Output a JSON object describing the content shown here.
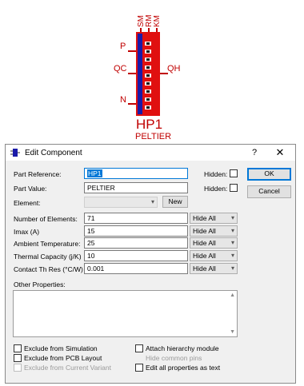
{
  "schematic": {
    "top_pins": [
      "SM",
      "RM",
      "KM"
    ],
    "left_pins": [
      "P",
      "QC",
      "N"
    ],
    "right_pins": [
      "QH"
    ],
    "reference": "HP1",
    "value": "PELTIER",
    "colors": {
      "wire": "#c00000",
      "body": "#e01010",
      "accent": "#1a1aa8"
    }
  },
  "dialog": {
    "title": "Edit Component",
    "help_label": "?",
    "close_label": "✕",
    "part_reference_label": "Part Reference:",
    "part_reference_value": "HP1",
    "part_value_label": "Part Value:",
    "part_value_value": "PELTIER",
    "element_label": "Element:",
    "element_value": "",
    "new_button": "New",
    "hidden_label": "Hidden:",
    "ok_button": "OK",
    "cancel_button": "Cancel",
    "properties": [
      {
        "label": "Number of Elements:",
        "value": "71",
        "visibility": "Hide All"
      },
      {
        "label": "Imax (A)",
        "value": "15",
        "visibility": "Hide All"
      },
      {
        "label": "Ambient Temperature:",
        "value": "25",
        "visibility": "Hide All"
      },
      {
        "label": "Thermal Capacity (j/K)",
        "value": "10",
        "visibility": "Hide All"
      },
      {
        "label": "Contact Th Res (°C/W)",
        "value": "0.001",
        "visibility": "Hide All"
      }
    ],
    "other_properties_label": "Other Properties:",
    "other_properties_value": "",
    "options": {
      "exclude_simulation": "Exclude from Simulation",
      "exclude_pcb": "Exclude from PCB Layout",
      "exclude_variant": "Exclude from Current Variant",
      "attach_hierarchy": "Attach hierarchy module",
      "hide_common_pins": "Hide common pins",
      "edit_all_text": "Edit all properties as text"
    }
  }
}
